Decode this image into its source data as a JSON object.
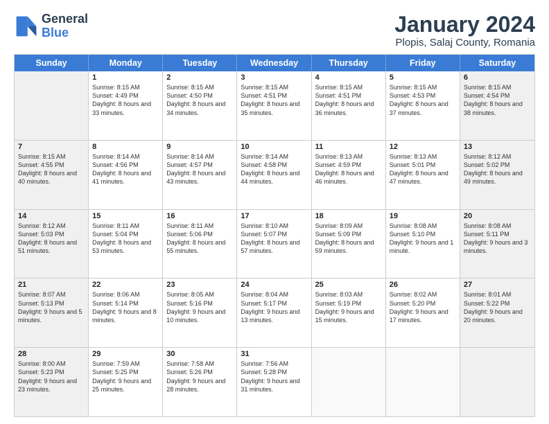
{
  "logo": {
    "line1": "General",
    "line2": "Blue"
  },
  "title": "January 2024",
  "subtitle": "Plopis, Salaj County, Romania",
  "header": {
    "days": [
      "Sunday",
      "Monday",
      "Tuesday",
      "Wednesday",
      "Thursday",
      "Friday",
      "Saturday"
    ]
  },
  "weeks": [
    [
      {
        "day": "",
        "sunrise": "",
        "sunset": "",
        "daylight": "",
        "shaded": true
      },
      {
        "day": "1",
        "sunrise": "Sunrise: 8:15 AM",
        "sunset": "Sunset: 4:49 PM",
        "daylight": "Daylight: 8 hours and 33 minutes.",
        "shaded": false
      },
      {
        "day": "2",
        "sunrise": "Sunrise: 8:15 AM",
        "sunset": "Sunset: 4:50 PM",
        "daylight": "Daylight: 8 hours and 34 minutes.",
        "shaded": false
      },
      {
        "day": "3",
        "sunrise": "Sunrise: 8:15 AM",
        "sunset": "Sunset: 4:51 PM",
        "daylight": "Daylight: 8 hours and 35 minutes.",
        "shaded": false
      },
      {
        "day": "4",
        "sunrise": "Sunrise: 8:15 AM",
        "sunset": "Sunset: 4:51 PM",
        "daylight": "Daylight: 8 hours and 36 minutes.",
        "shaded": false
      },
      {
        "day": "5",
        "sunrise": "Sunrise: 8:15 AM",
        "sunset": "Sunset: 4:53 PM",
        "daylight": "Daylight: 8 hours and 37 minutes.",
        "shaded": false
      },
      {
        "day": "6",
        "sunrise": "Sunrise: 8:15 AM",
        "sunset": "Sunset: 4:54 PM",
        "daylight": "Daylight: 8 hours and 38 minutes.",
        "shaded": true
      }
    ],
    [
      {
        "day": "7",
        "sunrise": "Sunrise: 8:15 AM",
        "sunset": "Sunset: 4:55 PM",
        "daylight": "Daylight: 8 hours and 40 minutes.",
        "shaded": true
      },
      {
        "day": "8",
        "sunrise": "Sunrise: 8:14 AM",
        "sunset": "Sunset: 4:56 PM",
        "daylight": "Daylight: 8 hours and 41 minutes.",
        "shaded": false
      },
      {
        "day": "9",
        "sunrise": "Sunrise: 8:14 AM",
        "sunset": "Sunset: 4:57 PM",
        "daylight": "Daylight: 8 hours and 43 minutes.",
        "shaded": false
      },
      {
        "day": "10",
        "sunrise": "Sunrise: 8:14 AM",
        "sunset": "Sunset: 4:58 PM",
        "daylight": "Daylight: 8 hours and 44 minutes.",
        "shaded": false
      },
      {
        "day": "11",
        "sunrise": "Sunrise: 8:13 AM",
        "sunset": "Sunset: 4:59 PM",
        "daylight": "Daylight: 8 hours and 46 minutes.",
        "shaded": false
      },
      {
        "day": "12",
        "sunrise": "Sunrise: 8:13 AM",
        "sunset": "Sunset: 5:01 PM",
        "daylight": "Daylight: 8 hours and 47 minutes.",
        "shaded": false
      },
      {
        "day": "13",
        "sunrise": "Sunrise: 8:12 AM",
        "sunset": "Sunset: 5:02 PM",
        "daylight": "Daylight: 8 hours and 49 minutes.",
        "shaded": true
      }
    ],
    [
      {
        "day": "14",
        "sunrise": "Sunrise: 8:12 AM",
        "sunset": "Sunset: 5:03 PM",
        "daylight": "Daylight: 8 hours and 51 minutes.",
        "shaded": true
      },
      {
        "day": "15",
        "sunrise": "Sunrise: 8:11 AM",
        "sunset": "Sunset: 5:04 PM",
        "daylight": "Daylight: 8 hours and 53 minutes.",
        "shaded": false
      },
      {
        "day": "16",
        "sunrise": "Sunrise: 8:11 AM",
        "sunset": "Sunset: 5:06 PM",
        "daylight": "Daylight: 8 hours and 55 minutes.",
        "shaded": false
      },
      {
        "day": "17",
        "sunrise": "Sunrise: 8:10 AM",
        "sunset": "Sunset: 5:07 PM",
        "daylight": "Daylight: 8 hours and 57 minutes.",
        "shaded": false
      },
      {
        "day": "18",
        "sunrise": "Sunrise: 8:09 AM",
        "sunset": "Sunset: 5:09 PM",
        "daylight": "Daylight: 8 hours and 59 minutes.",
        "shaded": false
      },
      {
        "day": "19",
        "sunrise": "Sunrise: 8:08 AM",
        "sunset": "Sunset: 5:10 PM",
        "daylight": "Daylight: 9 hours and 1 minute.",
        "shaded": false
      },
      {
        "day": "20",
        "sunrise": "Sunrise: 8:08 AM",
        "sunset": "Sunset: 5:11 PM",
        "daylight": "Daylight: 9 hours and 3 minutes.",
        "shaded": true
      }
    ],
    [
      {
        "day": "21",
        "sunrise": "Sunrise: 8:07 AM",
        "sunset": "Sunset: 5:13 PM",
        "daylight": "Daylight: 9 hours and 5 minutes.",
        "shaded": true
      },
      {
        "day": "22",
        "sunrise": "Sunrise: 8:06 AM",
        "sunset": "Sunset: 5:14 PM",
        "daylight": "Daylight: 9 hours and 8 minutes.",
        "shaded": false
      },
      {
        "day": "23",
        "sunrise": "Sunrise: 8:05 AM",
        "sunset": "Sunset: 5:16 PM",
        "daylight": "Daylight: 9 hours and 10 minutes.",
        "shaded": false
      },
      {
        "day": "24",
        "sunrise": "Sunrise: 8:04 AM",
        "sunset": "Sunset: 5:17 PM",
        "daylight": "Daylight: 9 hours and 13 minutes.",
        "shaded": false
      },
      {
        "day": "25",
        "sunrise": "Sunrise: 8:03 AM",
        "sunset": "Sunset: 5:19 PM",
        "daylight": "Daylight: 9 hours and 15 minutes.",
        "shaded": false
      },
      {
        "day": "26",
        "sunrise": "Sunrise: 8:02 AM",
        "sunset": "Sunset: 5:20 PM",
        "daylight": "Daylight: 9 hours and 17 minutes.",
        "shaded": false
      },
      {
        "day": "27",
        "sunrise": "Sunrise: 8:01 AM",
        "sunset": "Sunset: 5:22 PM",
        "daylight": "Daylight: 9 hours and 20 minutes.",
        "shaded": true
      }
    ],
    [
      {
        "day": "28",
        "sunrise": "Sunrise: 8:00 AM",
        "sunset": "Sunset: 5:23 PM",
        "daylight": "Daylight: 9 hours and 23 minutes.",
        "shaded": true
      },
      {
        "day": "29",
        "sunrise": "Sunrise: 7:59 AM",
        "sunset": "Sunset: 5:25 PM",
        "daylight": "Daylight: 9 hours and 25 minutes.",
        "shaded": false
      },
      {
        "day": "30",
        "sunrise": "Sunrise: 7:58 AM",
        "sunset": "Sunset: 5:26 PM",
        "daylight": "Daylight: 9 hours and 28 minutes.",
        "shaded": false
      },
      {
        "day": "31",
        "sunrise": "Sunrise: 7:56 AM",
        "sunset": "Sunset: 5:28 PM",
        "daylight": "Daylight: 9 hours and 31 minutes.",
        "shaded": false
      },
      {
        "day": "",
        "sunrise": "",
        "sunset": "",
        "daylight": "",
        "shaded": false
      },
      {
        "day": "",
        "sunrise": "",
        "sunset": "",
        "daylight": "",
        "shaded": false
      },
      {
        "day": "",
        "sunrise": "",
        "sunset": "",
        "daylight": "",
        "shaded": true
      }
    ]
  ]
}
